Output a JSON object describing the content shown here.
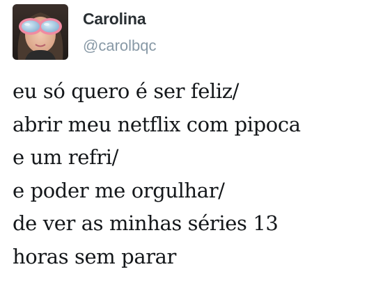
{
  "tweet": {
    "author": {
      "display_name": "Carolina",
      "handle": "@carolbqc"
    },
    "lines": [
      "eu só quero é ser feliz/",
      "abrir meu netflix com pipoca",
      "e um refri/",
      "e poder me orgulhar/",
      "de ver as minhas séries 13",
      "horas sem parar"
    ]
  },
  "colors": {
    "display_name": "#292f33",
    "handle": "#8899a6",
    "body_text": "#14171a",
    "background": "#ffffff"
  }
}
